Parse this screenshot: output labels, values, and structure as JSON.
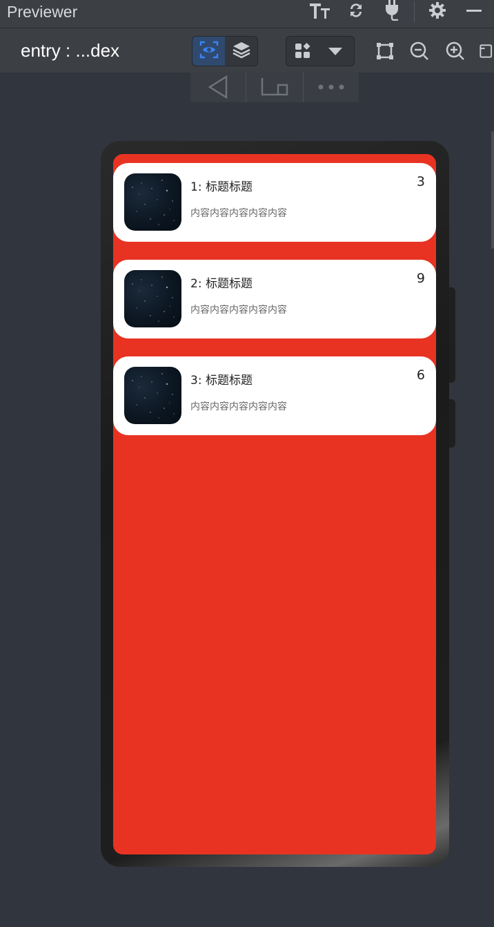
{
  "window": {
    "title": "Previewer"
  },
  "toolbar": {
    "entry_label": "entry : ...dex"
  },
  "colors": {
    "screen_bg": "#e83323",
    "accent": "#3b82f6",
    "card_bg": "#ffffff"
  },
  "icons": {
    "titlebar": [
      "font-size-icon",
      "refresh-icon",
      "plug-icon",
      "gear-icon",
      "minimize-icon"
    ],
    "toolbar": [
      "eye-inspect-icon",
      "layers-icon",
      "components-icon",
      "chevron-down-icon",
      "crop-icon",
      "zoom-out-icon",
      "zoom-in-icon",
      "frame-icon"
    ],
    "nav": [
      "back-icon",
      "home-icon",
      "more-icon"
    ]
  },
  "cards": [
    {
      "title": "1: 标题标题",
      "content": "内容内容内容内容内容",
      "count": "3"
    },
    {
      "title": "2: 标题标题",
      "content": "内容内容内容内容内容",
      "count": "9"
    },
    {
      "title": "3: 标题标题",
      "content": "内容内容内容内容内容",
      "count": "6"
    }
  ]
}
